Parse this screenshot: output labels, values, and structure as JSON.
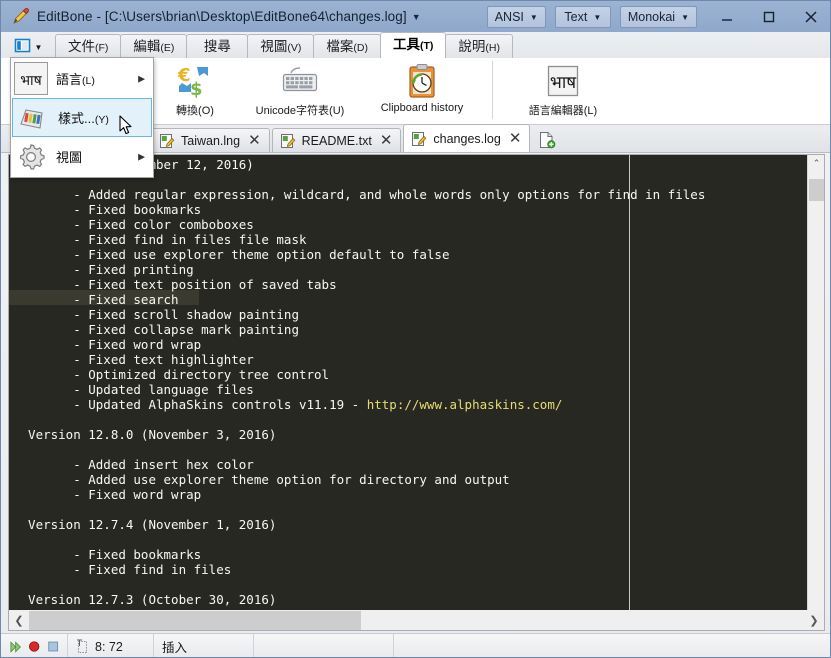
{
  "titlebar": {
    "app_name": "EditBone",
    "title": "EditBone  -  [C:\\Users\\brian\\Desktop\\EditBone64\\changes.log]",
    "caret": "▼",
    "app_icon": "pencil-icon",
    "combos": [
      {
        "name": "encoding",
        "label": "ANSI",
        "caret": "▼"
      },
      {
        "name": "file-type",
        "label": "Text",
        "caret": "▼"
      },
      {
        "name": "theme",
        "label": "Monokai",
        "caret": "▼"
      }
    ],
    "window_buttons": [
      {
        "name": "minimize",
        "glyph": "—"
      },
      {
        "name": "maximize",
        "glyph": "□"
      },
      {
        "name": "close",
        "glyph": "✕"
      }
    ]
  },
  "menubar": {
    "quick_access_caret": "▼",
    "tabs": [
      {
        "label": "文件",
        "mnemonic": "(F)",
        "active": false,
        "name": "file"
      },
      {
        "label": "編輯",
        "mnemonic": "(E)",
        "active": false,
        "name": "edit"
      },
      {
        "label": "搜尋",
        "mnemonic": "",
        "active": false,
        "name": "search"
      },
      {
        "label": "視圖",
        "mnemonic": "(V)",
        "active": false,
        "name": "view"
      },
      {
        "label": "檔案",
        "mnemonic": "(D)",
        "active": false,
        "name": "document"
      },
      {
        "label": "工具",
        "mnemonic": "(T)",
        "active": true,
        "name": "tools"
      },
      {
        "label": "說明",
        "mnemonic": "(H)",
        "active": false,
        "name": "help"
      }
    ]
  },
  "ribbon": {
    "items": [
      {
        "name": "convert",
        "label": "轉換(O)",
        "icon": "currency-convert-icon"
      },
      {
        "name": "unicode-char-map",
        "label": "Unicode字符表(U)",
        "icon": "keyboard-icon"
      },
      {
        "name": "clipboard-history",
        "label": "Clipboard history",
        "icon": "clipboard-clock-icon"
      },
      {
        "name": "language-editor",
        "label": "語言編輯器(L)",
        "icon": "devanagari-icon"
      }
    ]
  },
  "dropdown": {
    "items": [
      {
        "name": "language",
        "label": "語言",
        "mnemonic": "(L)",
        "arrow": "▶",
        "selected": false,
        "icon": "devanagari-icon"
      },
      {
        "name": "styles",
        "label": "樣式...",
        "mnemonic": "(Y)",
        "arrow": "",
        "selected": true,
        "icon": "color-palette-icon"
      },
      {
        "name": "options",
        "label": "視圖",
        "mnemonic": "",
        "arrow": "▶",
        "selected": false,
        "icon": "gear-icon"
      }
    ]
  },
  "filetabs": {
    "tabs": [
      {
        "name": "taiwan-lng",
        "label": "Taiwan.lng",
        "close": "✕",
        "active": false
      },
      {
        "name": "readme-txt",
        "label": "README.txt",
        "close": "✕",
        "active": false
      },
      {
        "name": "changes-log",
        "label": "changes.log",
        "close": "✕",
        "active": true
      }
    ],
    "new_tab_icon": "new-document-icon"
  },
  "editor": {
    "lines": "          .0 (November 12, 2016)\n\n        - Added regular expression, wildcard, and whole words only options for find in files\n        - Fixed bookmarks\n        - Fixed color comboboxes\n        - Fixed find in files file mask\n        - Fixed use explorer theme option default to false\n        - Fixed printing\n        - Fixed text position of saved tabs\n        - Fixed search\n        - Fixed scroll shadow painting\n        - Fixed collapse mark painting\n        - Fixed word wrap\n        - Fixed text highlighter\n        - Optimized directory tree control\n        - Updated language files\n        - Updated AlphaSkins controls v11.19 - ",
    "url": "http://www.alphaskins.com/",
    "lines_after": "\n\n  Version 12.8.0 (November 3, 2016)\n\n        - Added insert hex color\n        - Added use explorer theme option for directory and output\n        - Fixed word wrap\n\n  Version 12.7.4 (November 1, 2016)\n\n        - Fixed bookmarks\n        - Fixed find in files\n\n  Version 12.7.3 (October 30, 2016)",
    "background_color": "#272822",
    "text_color": "#f8f8f2",
    "url_color": "#e6db74",
    "scroll_up": "⌃",
    "scroll_down": "⌄",
    "scroll_left": "❮",
    "scroll_right": "❯"
  },
  "statusbar": {
    "play_icon": "play-icon",
    "record_icon": "record-icon",
    "stop_icon": "stop-icon",
    "position_icon": "caret-position-icon",
    "position": "8: 72",
    "insert_mode": "插入",
    "blank1": "",
    "blank2": ""
  }
}
